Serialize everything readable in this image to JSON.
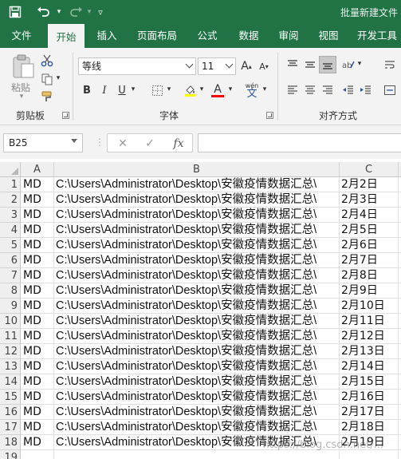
{
  "window": {
    "title": "批量新建文件"
  },
  "ribbon_tabs": [
    {
      "label": "文件",
      "active": false
    },
    {
      "label": "开始",
      "active": true
    },
    {
      "label": "插入",
      "active": false
    },
    {
      "label": "页面布局",
      "active": false
    },
    {
      "label": "公式",
      "active": false
    },
    {
      "label": "数据",
      "active": false
    },
    {
      "label": "审阅",
      "active": false
    },
    {
      "label": "视图",
      "active": false
    },
    {
      "label": "开发工具",
      "active": false
    }
  ],
  "ribbon": {
    "clipboard": {
      "label": "剪贴板",
      "paste_label": "粘贴"
    },
    "font": {
      "label": "字体",
      "font_name": "等线",
      "font_size": "11",
      "bold": "B",
      "italic": "I",
      "underline": "U",
      "font_color_letter": "A",
      "wen_label": "wén",
      "wen_char": "文"
    },
    "alignment": {
      "label": "对齐方式"
    },
    "colors": {
      "highlight": "#ffff00",
      "font_color": "#ff0000",
      "accent": "#217346"
    }
  },
  "formula_bar": {
    "name_box": "B25",
    "cancel": "✕",
    "enter": "✓",
    "fx": "fx",
    "formula": ""
  },
  "grid": {
    "columns": [
      "A",
      "B",
      "C"
    ],
    "rows": [
      {
        "num": "1",
        "a": "MD",
        "b": "C:\\Users\\Administrator\\Desktop\\安徽疫情数据汇总\\",
        "c": "2月2日"
      },
      {
        "num": "2",
        "a": "MD",
        "b": "C:\\Users\\Administrator\\Desktop\\安徽疫情数据汇总\\",
        "c": "2月3日"
      },
      {
        "num": "3",
        "a": "MD",
        "b": "C:\\Users\\Administrator\\Desktop\\安徽疫情数据汇总\\",
        "c": "2月4日"
      },
      {
        "num": "4",
        "a": "MD",
        "b": "C:\\Users\\Administrator\\Desktop\\安徽疫情数据汇总\\",
        "c": "2月5日"
      },
      {
        "num": "5",
        "a": "MD",
        "b": "C:\\Users\\Administrator\\Desktop\\安徽疫情数据汇总\\",
        "c": "2月6日"
      },
      {
        "num": "6",
        "a": "MD",
        "b": "C:\\Users\\Administrator\\Desktop\\安徽疫情数据汇总\\",
        "c": "2月7日"
      },
      {
        "num": "7",
        "a": "MD",
        "b": "C:\\Users\\Administrator\\Desktop\\安徽疫情数据汇总\\",
        "c": "2月8日"
      },
      {
        "num": "8",
        "a": "MD",
        "b": "C:\\Users\\Administrator\\Desktop\\安徽疫情数据汇总\\",
        "c": "2月9日"
      },
      {
        "num": "9",
        "a": "MD",
        "b": "C:\\Users\\Administrator\\Desktop\\安徽疫情数据汇总\\",
        "c": "2月10日"
      },
      {
        "num": "10",
        "a": "MD",
        "b": "C:\\Users\\Administrator\\Desktop\\安徽疫情数据汇总\\",
        "c": "2月11日"
      },
      {
        "num": "11",
        "a": "MD",
        "b": "C:\\Users\\Administrator\\Desktop\\安徽疫情数据汇总\\",
        "c": "2月12日"
      },
      {
        "num": "12",
        "a": "MD",
        "b": "C:\\Users\\Administrator\\Desktop\\安徽疫情数据汇总\\",
        "c": "2月13日"
      },
      {
        "num": "13",
        "a": "MD",
        "b": "C:\\Users\\Administrator\\Desktop\\安徽疫情数据汇总\\",
        "c": "2月14日"
      },
      {
        "num": "14",
        "a": "MD",
        "b": "C:\\Users\\Administrator\\Desktop\\安徽疫情数据汇总\\",
        "c": "2月15日"
      },
      {
        "num": "15",
        "a": "MD",
        "b": "C:\\Users\\Administrator\\Desktop\\安徽疫情数据汇总\\",
        "c": "2月16日"
      },
      {
        "num": "16",
        "a": "MD",
        "b": "C:\\Users\\Administrator\\Desktop\\安徽疫情数据汇总\\",
        "c": "2月17日"
      },
      {
        "num": "17",
        "a": "MD",
        "b": "C:\\Users\\Administrator\\Desktop\\安徽疫情数据汇总\\",
        "c": "2月18日"
      },
      {
        "num": "18",
        "a": "MD",
        "b": "C:\\Users\\Administrator\\Desktop\\安徽疫情数据汇总\\",
        "c": "2月19日"
      },
      {
        "num": "19",
        "a": "",
        "b": "",
        "c": ""
      }
    ]
  },
  "watermark": "https://blog.csdn.net/..."
}
